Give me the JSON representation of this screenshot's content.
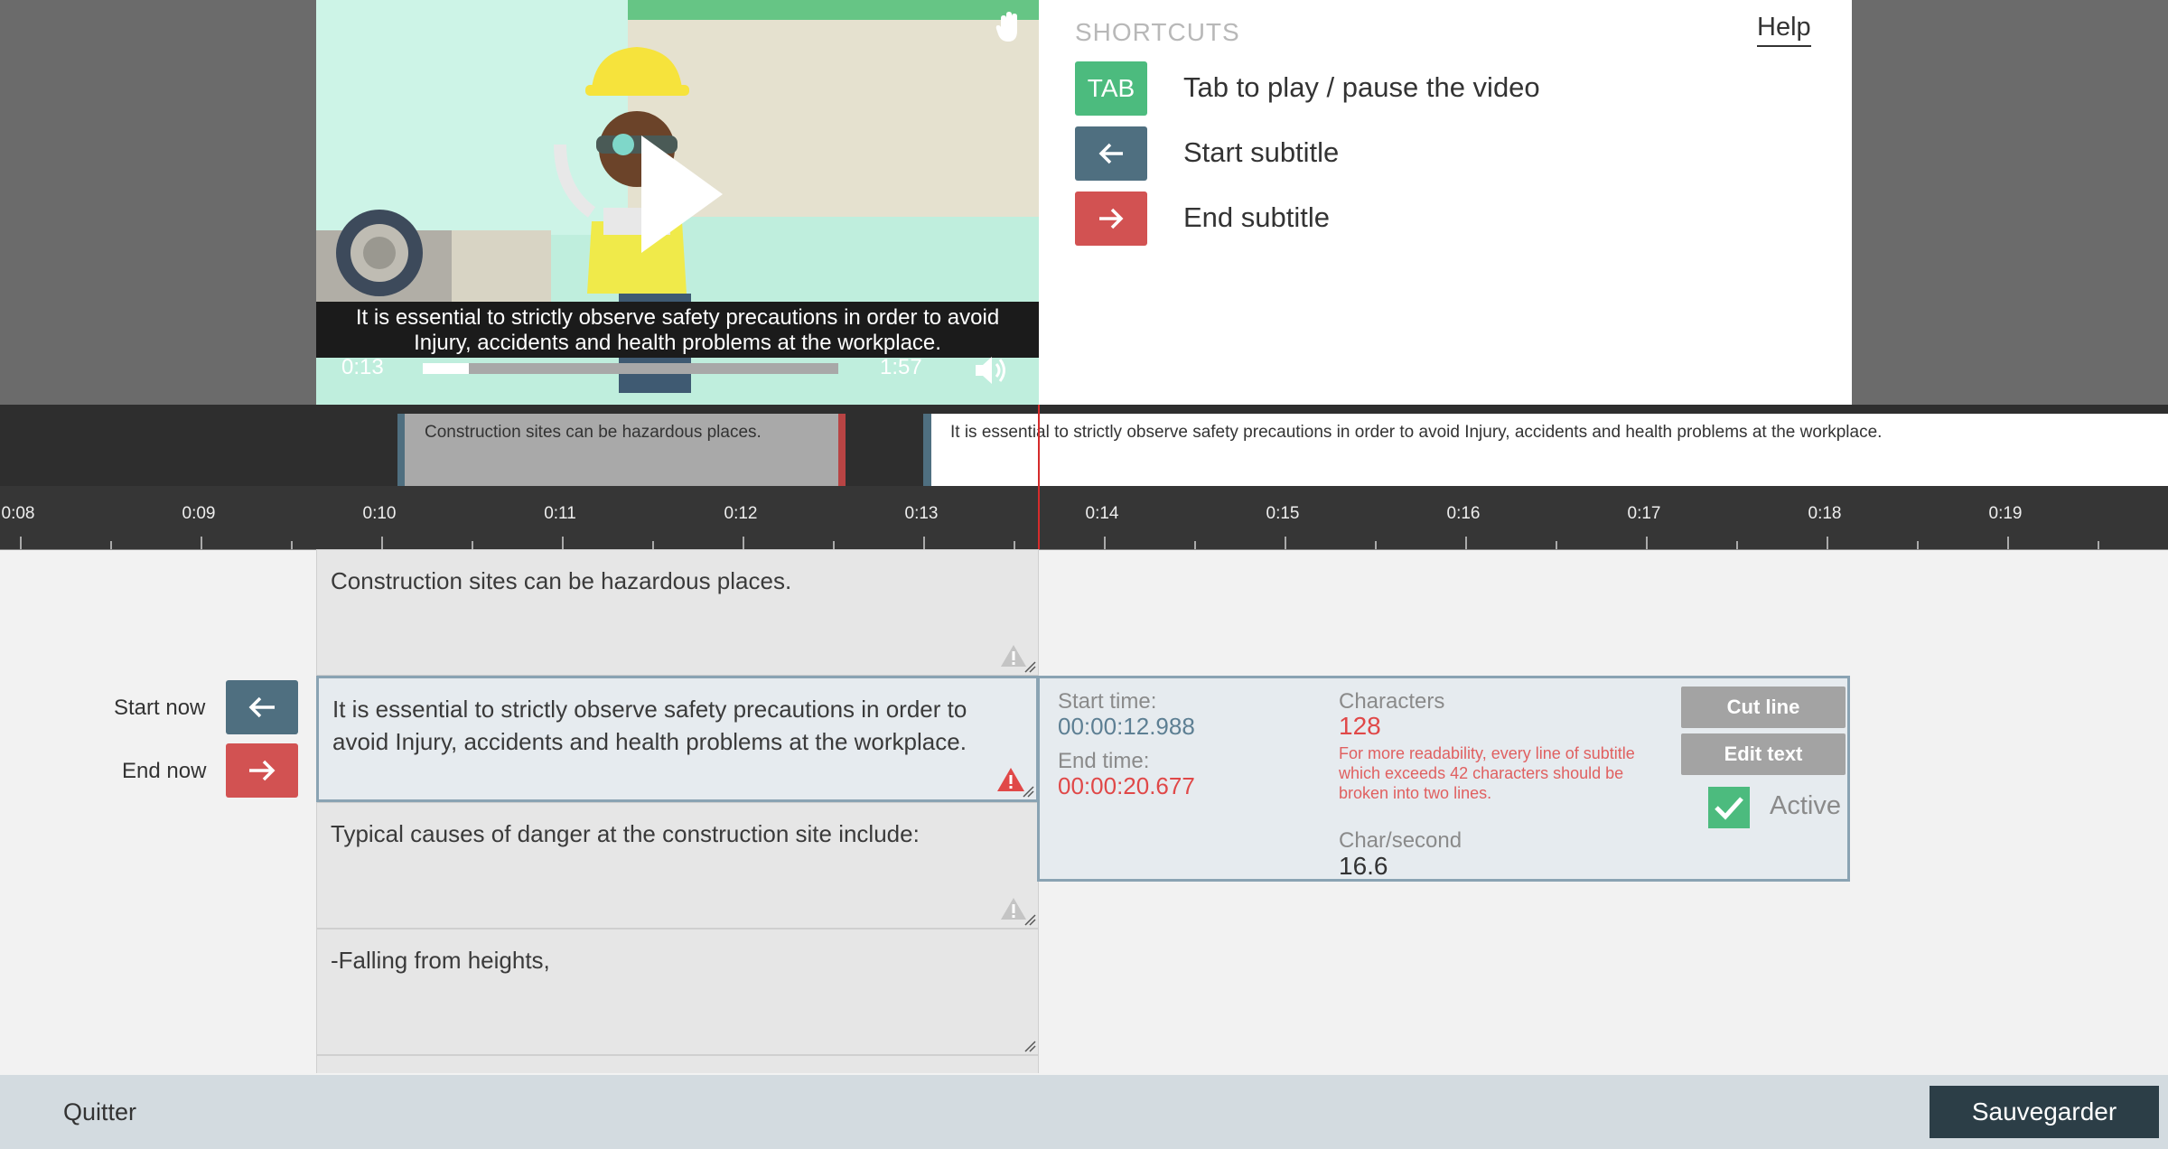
{
  "video": {
    "caption_line1": "It is essential to strictly observe safety precautions in order to avoid",
    "caption_line2": "Injury, accidents and health problems at the workplace.",
    "current_time": "0:13",
    "duration": "1:57",
    "progress": 0.11
  },
  "shortcuts": {
    "title": "SHORTCUTS",
    "help_label": "Help",
    "items": [
      {
        "key": "TAB",
        "label": "Tab to play / pause the video",
        "color": "#4cbb7e"
      },
      {
        "key": "←",
        "label": "Start subtitle",
        "color": "#4f6f80"
      },
      {
        "key": "→",
        "label": "End subtitle",
        "color": "#d25252"
      }
    ]
  },
  "track": {
    "blocks": [
      {
        "text": "Construction sites can be hazardous places."
      },
      {
        "text": "It is essential to strictly observe safety precautions in order to avoid Injury, accidents and health problems at the workplace."
      }
    ]
  },
  "ruler": {
    "labels": [
      "0:08",
      "0:09",
      "0:10",
      "0:11",
      "0:12",
      "0:13",
      "0:14",
      "0:15",
      "0:16",
      "0:17",
      "0:18",
      "0:19"
    ]
  },
  "subtitles": [
    {
      "text": "Construction sites can be hazardous places."
    },
    {
      "text": "It is essential to strictly observe safety precautions in order to avoid Injury, accidents and health problems at the workplace."
    },
    {
      "text": "Typical causes of danger at the construction site include:"
    },
    {
      "text": "-Falling from heights,"
    }
  ],
  "controls": {
    "start_now_label": "Start now",
    "end_now_label": "End now"
  },
  "active": {
    "start_time_label": "Start time:",
    "start_time": "00:00:12.988",
    "end_time_label": "End time:",
    "end_time": "00:00:20.677",
    "characters_label": "Characters",
    "characters": "128",
    "warning": "For more readability, every line of subtitle which exceeds 42 characters should be broken into two lines.",
    "char_per_sec_label": "Char/second",
    "char_per_sec": "16.6",
    "cut_line_label": "Cut line",
    "edit_text_label": "Edit text",
    "active_label": "Active",
    "active_checked": true
  },
  "bottom": {
    "quit_label": "Quitter",
    "save_label": "Sauvegarder"
  },
  "colors": {
    "green": "#4cbb7e",
    "slate": "#4f6f80",
    "red": "#d25252",
    "warning_red": "#e04848"
  }
}
